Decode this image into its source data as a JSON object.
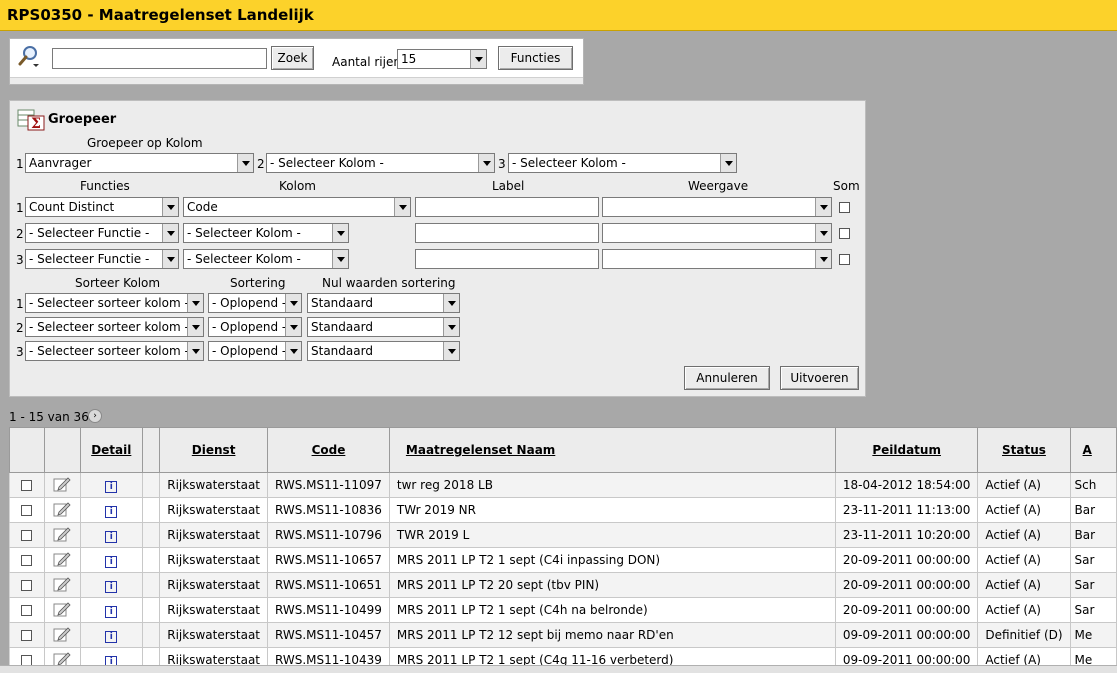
{
  "title": "RPS0350 - Maatregelenset Landelijk",
  "search": {
    "value": "",
    "zoek_label": "Zoek",
    "rows_label": "Aantal rijen",
    "rows_value": "15",
    "functies_label": "Functies"
  },
  "groepeer": {
    "title": "Groepeer",
    "group_by_header": "Groepeer op Kolom",
    "group_cols": [
      {
        "num": "1",
        "value": "Aanvrager"
      },
      {
        "num": "2",
        "value": "- Selecteer Kolom -"
      },
      {
        "num": "3",
        "value": "- Selecteer Kolom -"
      }
    ],
    "headers": {
      "functies": "Functies",
      "kolom": "Kolom",
      "label": "Label",
      "weergave": "Weergave",
      "som": "Som"
    },
    "function_rows": [
      {
        "num": "1",
        "functie": "Count Distinct",
        "kolom": "Code"
      },
      {
        "num": "2",
        "functie": "- Selecteer Functie -",
        "kolom": "- Selecteer Kolom -"
      },
      {
        "num": "3",
        "functie": "- Selecteer Functie -",
        "kolom": "- Selecteer Kolom -"
      }
    ],
    "sort_headers": {
      "kolom": "Sorteer Kolom",
      "sortering": "Sortering",
      "nul": "Nul waarden sortering"
    },
    "sort_rows": [
      {
        "num": "1",
        "kolom": "- Selecteer sorteer kolom -",
        "sortering": "- Oplopend -",
        "nul": "Standaard"
      },
      {
        "num": "2",
        "kolom": "- Selecteer sorteer kolom -",
        "sortering": "- Oplopend -",
        "nul": "Standaard"
      },
      {
        "num": "3",
        "kolom": "- Selecteer sorteer kolom -",
        "sortering": "- Oplopend -",
        "nul": "Standaard"
      }
    ],
    "cancel_label": "Annuleren",
    "run_label": "Uitvoeren"
  },
  "pager": {
    "text": "1 - 15 van 36"
  },
  "table": {
    "headers": {
      "detail": "Detail",
      "dienst": "Dienst",
      "code": "Code",
      "naam": "Maatregelenset Naam",
      "peildatum": "Peildatum",
      "status": "Status",
      "aanvrager": "A"
    },
    "rows": [
      {
        "dienst": "Rijkswaterstaat",
        "code": "RWS.MS11-11097",
        "naam": "twr reg 2018 LB",
        "peildatum": "18-04-2012 18:54:00",
        "status": "Actief (A)",
        "aanvrager": "Sch"
      },
      {
        "dienst": "Rijkswaterstaat",
        "code": "RWS.MS11-10836",
        "naam": "TWr 2019 NR",
        "peildatum": "23-11-2011 11:13:00",
        "status": "Actief (A)",
        "aanvrager": "Bar"
      },
      {
        "dienst": "Rijkswaterstaat",
        "code": "RWS.MS11-10796",
        "naam": "TWR 2019 L",
        "peildatum": "23-11-2011 10:20:00",
        "status": "Actief (A)",
        "aanvrager": "Bar"
      },
      {
        "dienst": "Rijkswaterstaat",
        "code": "RWS.MS11-10657",
        "naam": "MRS 2011 LP T2 1 sept (C4i inpassing DON)",
        "peildatum": "20-09-2011 00:00:00",
        "status": "Actief (A)",
        "aanvrager": "Sar"
      },
      {
        "dienst": "Rijkswaterstaat",
        "code": "RWS.MS11-10651",
        "naam": "MRS 2011 LP T2 20 sept (tbv PIN)",
        "peildatum": "20-09-2011 00:00:00",
        "status": "Actief (A)",
        "aanvrager": "Sar"
      },
      {
        "dienst": "Rijkswaterstaat",
        "code": "RWS.MS11-10499",
        "naam": "MRS 2011 LP T2 1 sept (C4h na belronde)",
        "peildatum": "20-09-2011 00:00:00",
        "status": "Actief (A)",
        "aanvrager": "Sar"
      },
      {
        "dienst": "Rijkswaterstaat",
        "code": "RWS.MS11-10457",
        "naam": "MRS 2011 LP T2 12 sept bij memo naar RD'en",
        "peildatum": "09-09-2011 00:00:00",
        "status": "Definitief (D)",
        "aanvrager": "Me"
      },
      {
        "dienst": "Rijkswaterstaat",
        "code": "RWS.MS11-10439",
        "naam": "MRS 2011 LP T2 1 sept (C4g 11-16 verbeterd)",
        "peildatum": "09-09-2011 00:00:00",
        "status": "Actief (A)",
        "aanvrager": "Me"
      }
    ]
  }
}
